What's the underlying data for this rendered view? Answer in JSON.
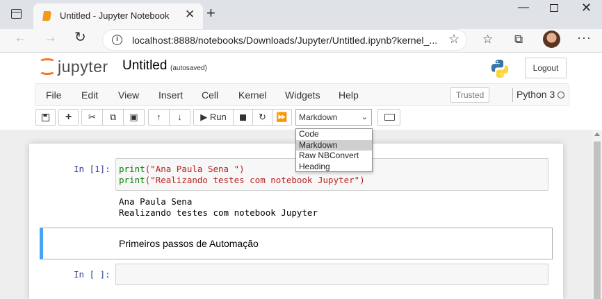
{
  "browser": {
    "tab_title": "Untitled - Jupyter Notebook",
    "tab_close": "✕",
    "new_tab": "+",
    "url": "localhost:8888/notebooks/Downloads/Jupyter/Untitled.ipynb?kernel_...",
    "window_minimize": "—",
    "window_close": "✕"
  },
  "header": {
    "logo_text": "jupyter",
    "notebook_title": "Untitled",
    "autosave_status": "(autosaved)",
    "logout_label": "Logout"
  },
  "menu": {
    "items": [
      "File",
      "Edit",
      "View",
      "Insert",
      "Cell",
      "Kernel",
      "Widgets",
      "Help"
    ],
    "trusted_label": "Trusted",
    "kernel_name": "Python 3"
  },
  "toolbar": {
    "run_label": "Run",
    "cell_type_selected": "Markdown"
  },
  "cell_type_options": [
    "Code",
    "Markdown",
    "Raw NBConvert",
    "Heading"
  ],
  "cells": {
    "code1": {
      "prompt": "In [1]:",
      "line1_fn": "print",
      "line1_str": "(\"Ana Paula Sena \")",
      "line2_fn": "print",
      "line2_str": "(\"Realizando testes com notebook Jupyter\")",
      "output_line1": "Ana Paula Sena",
      "output_line2": "Realizando testes com notebook Jupyter"
    },
    "markdown1": {
      "text": "Primeiros passos de Automação"
    },
    "code2": {
      "prompt": "In [ ]:"
    }
  },
  "colors": {
    "jupyter_orange": "#f37726",
    "prompt_blue": "#303f9f",
    "selected_cell_blue": "#42a5f5",
    "string_red": "#ba2121",
    "builtin_green": "#008000"
  }
}
